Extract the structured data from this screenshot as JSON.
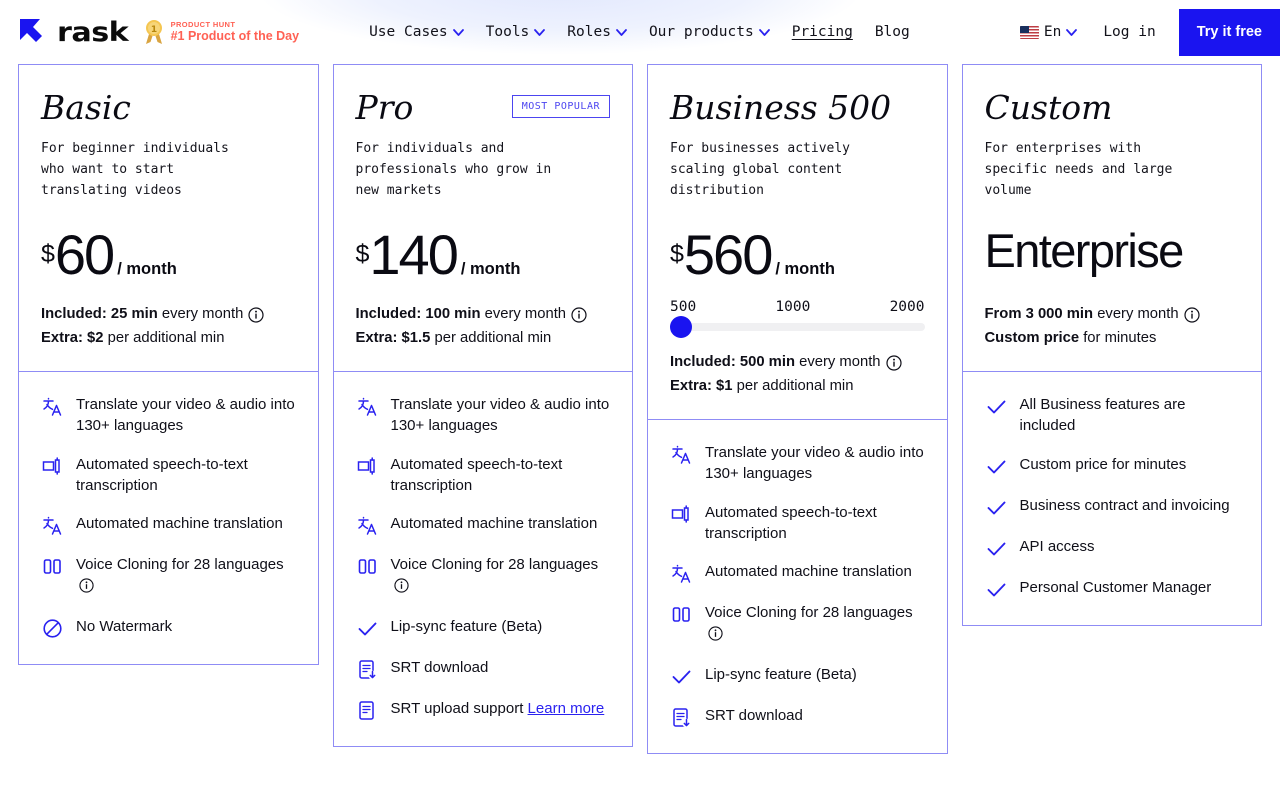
{
  "header": {
    "brand_name": "rask",
    "logo_icon": "rask-arrow-logo",
    "product_hunt": {
      "kicker": "PRODUCT HUNT",
      "title": "#1 Product of the Day",
      "medal_icon": "product-hunt-medal-icon",
      "color": "#ff6154"
    },
    "nav": [
      {
        "label": "Use Cases",
        "has_chevron": true,
        "active": false
      },
      {
        "label": "Tools",
        "has_chevron": true,
        "active": false
      },
      {
        "label": "Roles",
        "has_chevron": true,
        "active": false
      },
      {
        "label": "Our products",
        "has_chevron": true,
        "active": false
      },
      {
        "label": "Pricing",
        "has_chevron": false,
        "active": true
      },
      {
        "label": "Blog",
        "has_chevron": false,
        "active": false
      }
    ],
    "language": {
      "label": "En",
      "flag_icon": "us-flag-icon",
      "chevron_icon": "chevron-down-icon"
    },
    "login_label": "Log in",
    "cta_label": "Try it free",
    "accent_color": "#1a14f0"
  },
  "plans": [
    {
      "name": "Basic",
      "badge": null,
      "description": "For beginner individuals\nwho want to start\ntranslating videos",
      "currency": "$",
      "amount": "60",
      "period": "/ month",
      "included_label": "Included: 25 min",
      "included_suffix": "every month",
      "extra_label": "Extra: $2",
      "extra_suffix": "per additional min",
      "slider": null,
      "features": [
        {
          "icon": "translate-icon",
          "text": "Translate your video & audio into 130+ languages"
        },
        {
          "icon": "speech-to-text-icon",
          "text": "Automated speech-to-text transcription"
        },
        {
          "icon": "translate-icon",
          "text": "Automated machine translation"
        },
        {
          "icon": "voice-cloning-icon",
          "text": "Voice Cloning for 28 languages",
          "info": true
        },
        {
          "icon": "no-watermark-icon",
          "text": "No Watermark"
        }
      ]
    },
    {
      "name": "Pro",
      "badge": "MOST POPULAR",
      "description": "For individuals and\nprofessionals who grow in\nnew markets",
      "currency": "$",
      "amount": "140",
      "period": "/ month",
      "included_label": "Included: 100 min",
      "included_suffix": "every month",
      "extra_label": "Extra: $1.5",
      "extra_suffix": "per additional min",
      "slider": null,
      "features": [
        {
          "icon": "translate-icon",
          "text": "Translate your video & audio into 130+ languages"
        },
        {
          "icon": "speech-to-text-icon",
          "text": "Automated speech-to-text transcription"
        },
        {
          "icon": "translate-icon",
          "text": "Automated machine translation"
        },
        {
          "icon": "voice-cloning-icon",
          "text": "Voice Cloning for 28 languages",
          "info": true
        },
        {
          "icon": "check-icon",
          "text": "Lip-sync feature (Beta)"
        },
        {
          "icon": "srt-download-icon",
          "text": "SRT download"
        },
        {
          "icon": "srt-upload-icon",
          "text": "SRT upload support ",
          "link": "Learn more"
        }
      ]
    },
    {
      "name": "Business 500",
      "badge": null,
      "description": "For businesses actively\nscaling global content\ndistribution",
      "currency": "$",
      "amount": "560",
      "period": "/ month",
      "included_label": "Included: 500 min",
      "included_suffix": "every month",
      "extra_label": "Extra: $1",
      "extra_suffix": "per additional min",
      "slider": {
        "ticks": [
          "500",
          "1000",
          "2000"
        ],
        "value": 500,
        "min": 500,
        "max": 2000,
        "knob_percent": 0
      },
      "features": [
        {
          "icon": "translate-icon",
          "text": "Translate your video & audio into 130+ languages"
        },
        {
          "icon": "speech-to-text-icon",
          "text": "Automated speech-to-text transcription"
        },
        {
          "icon": "translate-icon",
          "text": "Automated machine translation"
        },
        {
          "icon": "voice-cloning-icon",
          "text": "Voice Cloning for 28 languages",
          "info": true
        },
        {
          "icon": "check-icon",
          "text": "Lip-sync feature (Beta)"
        },
        {
          "icon": "srt-download-icon",
          "text": "SRT download"
        }
      ]
    },
    {
      "name": "Custom",
      "badge": null,
      "description": "For enterprises with\nspecific needs and large\nvolume",
      "currency": "",
      "amount": "Enterprise",
      "period": "",
      "included_label": "From 3 000 min",
      "included_suffix": "every month",
      "extra_label": "Custom price",
      "extra_suffix": "for minutes",
      "slider": null,
      "features": [
        {
          "icon": "check-icon",
          "text": "All Business features are included"
        },
        {
          "icon": "check-icon",
          "text": "Custom price for minutes"
        },
        {
          "icon": "check-icon",
          "text": "Business contract and invoicing"
        },
        {
          "icon": "check-icon",
          "text": "API access"
        },
        {
          "icon": "check-icon",
          "text": "Personal Customer Manager"
        }
      ]
    }
  ],
  "colors": {
    "accent_blue": "#1a14f0",
    "card_border": "#8f8cf5",
    "badge_blue": "#4c45f0",
    "text": "#0f0f18",
    "product_hunt_red": "#ff6154"
  }
}
